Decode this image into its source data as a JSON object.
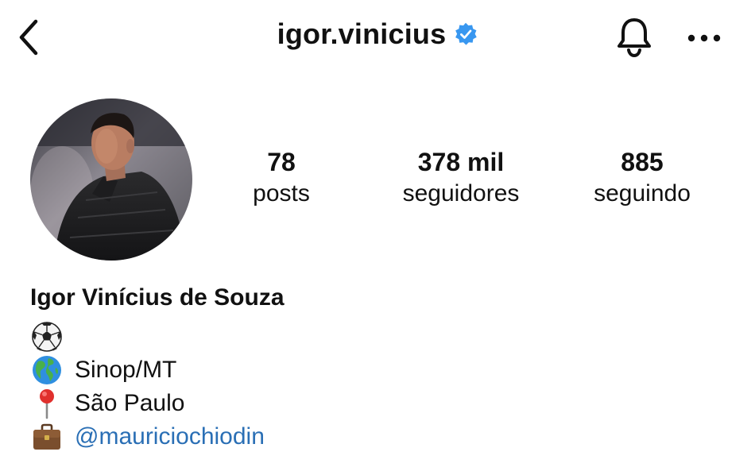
{
  "header": {
    "username": "igor.vinicius",
    "verified": true,
    "back_icon": "chevron-left-icon",
    "bell_icon": "bell-icon",
    "more_icon": "more-horizontal-icon"
  },
  "stats": {
    "posts_value": "78",
    "posts_label": "posts",
    "followers_value": "378 mil",
    "followers_label": "seguidores",
    "following_value": "885",
    "following_label": "seguindo"
  },
  "bio": {
    "full_name": "Igor Vinícius de Souza",
    "line1_icon": "soccer-ball-icon",
    "line2_icon": "globe-icon",
    "line2_text": "Sinop/MT",
    "line3_icon": "pin-icon",
    "line3_text": "São Paulo",
    "line4_icon": "briefcase-icon",
    "line4_mention": "@mauriciochiodin"
  },
  "colors": {
    "verified_blue": "#3897f0",
    "mention_blue": "#2a6fb5",
    "text": "#111111",
    "background": "#ffffff"
  }
}
